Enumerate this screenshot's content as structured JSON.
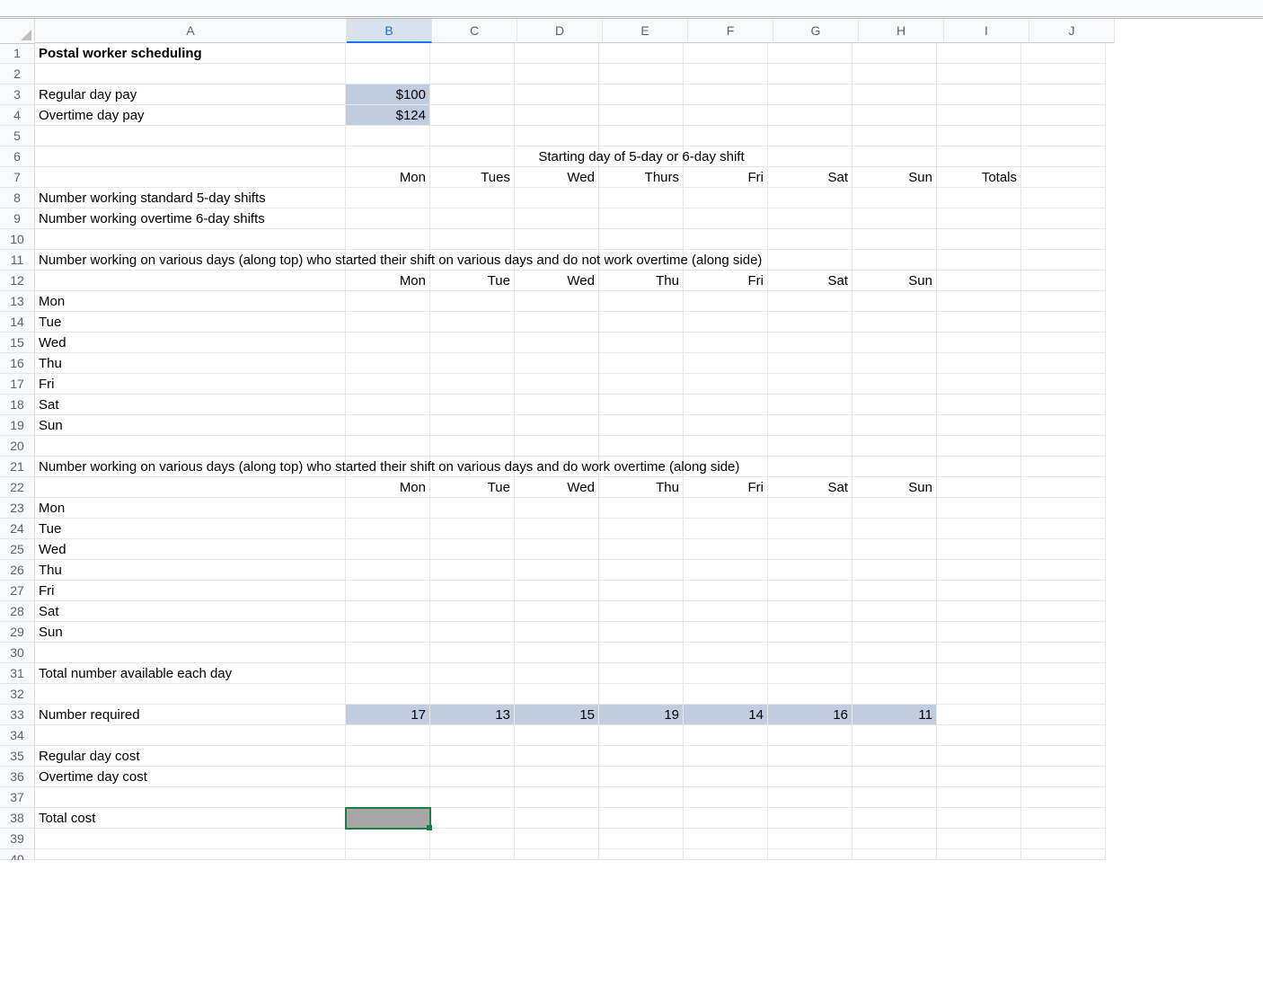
{
  "columns": [
    "A",
    "B",
    "C",
    "D",
    "E",
    "F",
    "G",
    "H",
    "I",
    "J"
  ],
  "activeCol": "B",
  "activeCell": "B38",
  "rowCount": 40,
  "labels": {
    "title": "Postal worker scheduling",
    "reg_pay_label": "Regular day pay",
    "ot_pay_label": "Overtime day pay",
    "reg_pay_value": "$100",
    "ot_pay_value": "$124",
    "shift_header": "Starting day of 5-day or 6-day shift",
    "days_full": [
      "Mon",
      "Tues",
      "Wed",
      "Thurs",
      "Fri",
      "Sat",
      "Sun"
    ],
    "totals": "Totals",
    "std_shifts": "Number working standard 5-day shifts",
    "ot_shifts": "Number working overtime 6-day shifts",
    "block1_header": "Number working on various days (along top) who started their shift on various days and do not work overtime (along side)",
    "block2_header": "Number working on various days (along top) who started their shift on various days and do work overtime (along side)",
    "days_short": [
      "Mon",
      "Tue",
      "Wed",
      "Thu",
      "Fri",
      "Sat",
      "Sun"
    ],
    "total_avail": "Total number available each day",
    "num_required": "Number required",
    "required_vals": [
      "17",
      "13",
      "15",
      "19",
      "14",
      "16",
      "11"
    ],
    "reg_cost": "Regular day cost",
    "ot_cost": "Overtime day cost",
    "total_cost": "Total cost"
  }
}
